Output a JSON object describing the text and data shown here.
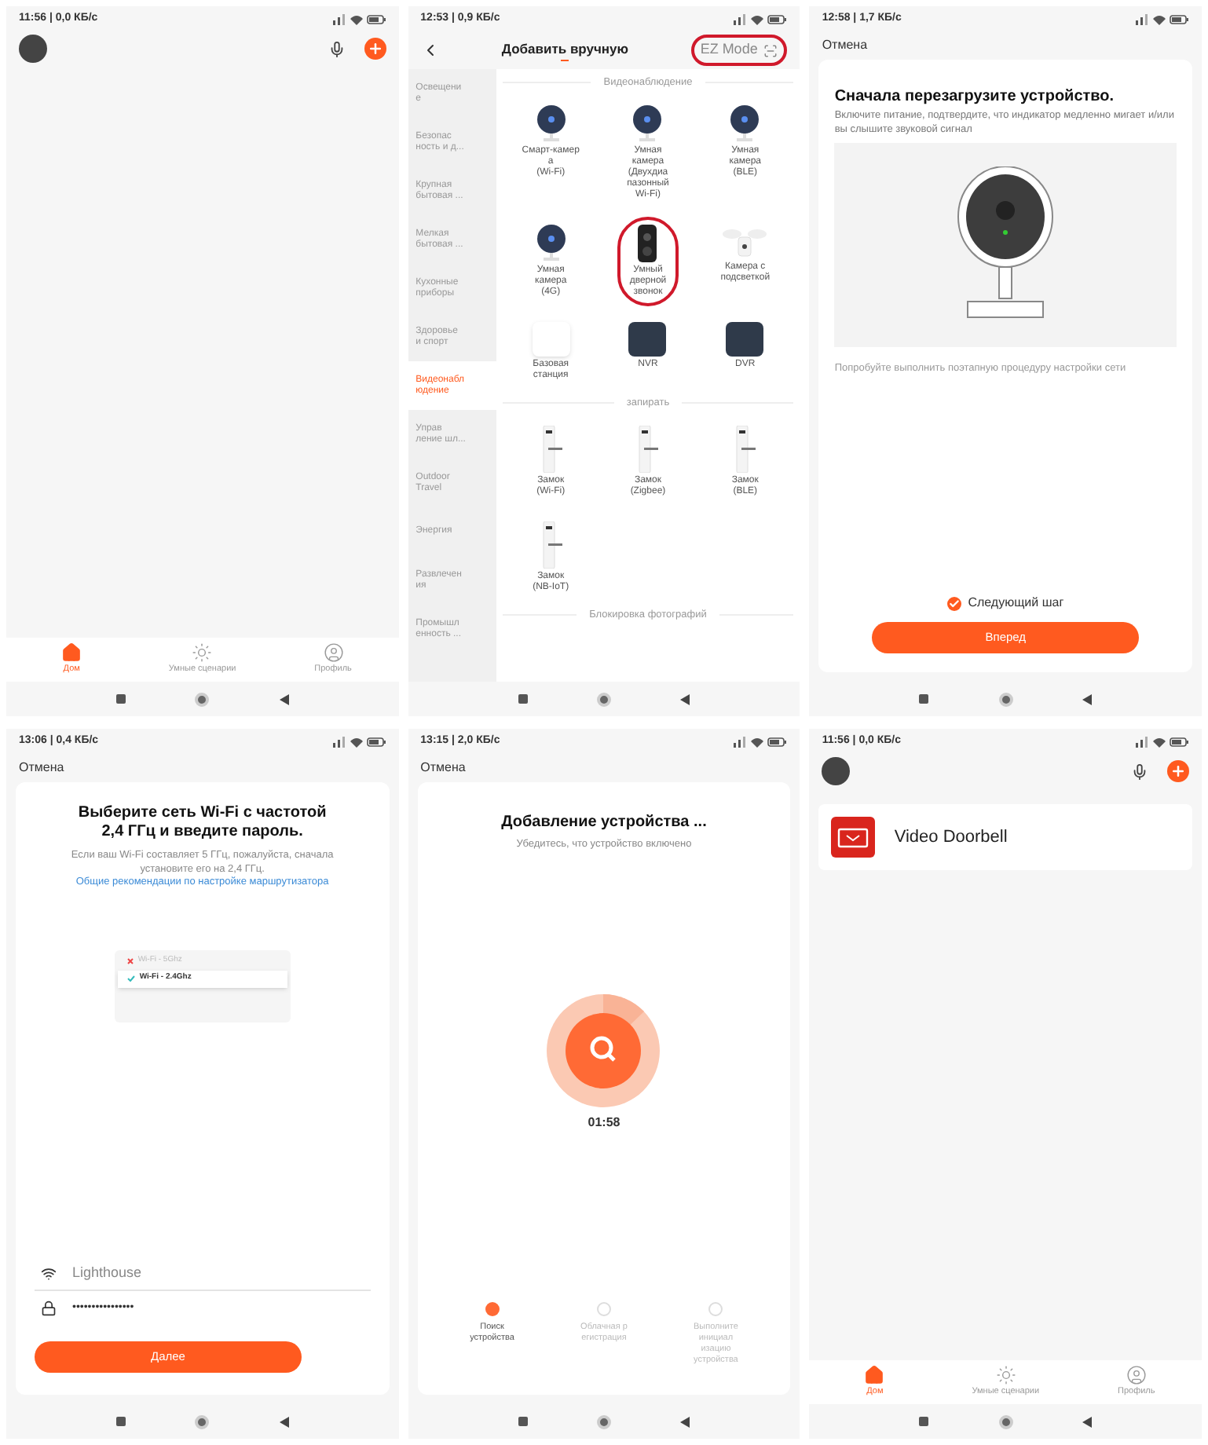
{
  "screens": [
    {
      "kind": "home",
      "status": "11:56 | 0,0 КБ/с",
      "tabs": [
        {
          "kind": "home",
          "label": "Дом",
          "selected": true
        },
        {
          "kind": "scenes",
          "label": "Умные сценарии",
          "selected": false
        },
        {
          "kind": "profile",
          "label": "Профиль",
          "selected": false
        }
      ]
    },
    {
      "kind": "catalog",
      "status": "12:53 | 0,9 КБ/с",
      "title": "Добавить вручную",
      "ez_mode": {
        "label": "EZ Mode",
        "circled": true
      },
      "categories": [
        {
          "label": "Освещени\nе",
          "selected": false
        },
        {
          "label": "Безопас\nность и д...",
          "selected": false
        },
        {
          "label": "Крупная\nбытовая ...",
          "selected": false
        },
        {
          "label": "Мелкая\nбытовая ...",
          "selected": false
        },
        {
          "label": "Кухонные\nприборы",
          "selected": false
        },
        {
          "label": "Здоровье\nи спорт",
          "selected": false
        },
        {
          "label": "Видеонабл\nюдение",
          "selected": true
        },
        {
          "label": "Управ\nление шл...",
          "selected": false
        },
        {
          "label": "Outdoor\nTravel",
          "selected": false
        },
        {
          "label": "Энергия",
          "selected": false
        },
        {
          "label": "Развлечен\nия",
          "selected": false
        },
        {
          "label": "Промышл\nенность ...",
          "selected": false
        }
      ],
      "sections": [
        {
          "title": "Видеонаблюдение",
          "items": [
            {
              "kind": "camera",
              "label": "Смарт-камер\nа\n(Wi-Fi)",
              "circled": false
            },
            {
              "kind": "camera",
              "label": "Умная\nкамера\n(Двухдиа\nпазонный\nWi-Fi)",
              "circled": false
            },
            {
              "kind": "camera",
              "label": "Умная\nкамера\n(BLE)",
              "circled": false
            },
            {
              "kind": "camera",
              "label": "Умная\nкамера\n(4G)",
              "circled": false
            },
            {
              "kind": "doorbell",
              "label": "Умный\nдверной\nзвонок",
              "circled": true
            },
            {
              "kind": "floodlight",
              "label": "Камера с\nподсветкой",
              "circled": false
            },
            {
              "kind": "hub",
              "label": "Базовая\nстанция",
              "circled": false
            },
            {
              "kind": "recorder",
              "label": "NVR",
              "circled": false
            },
            {
              "kind": "recorder",
              "label": "DVR",
              "circled": false
            }
          ]
        },
        {
          "title": "запирать",
          "items": [
            {
              "kind": "lock",
              "label": "Замок\n(Wi-Fi)",
              "circled": false
            },
            {
              "kind": "lock",
              "label": "Замок\n(Zigbee)",
              "circled": false
            },
            {
              "kind": "lock",
              "label": "Замок\n(BLE)",
              "circled": false
            },
            {
              "kind": "lock",
              "label": "Замок\n(NB-IoT)",
              "circled": false
            }
          ]
        },
        {
          "title": "Блокировка фотографий"
        }
      ]
    },
    {
      "kind": "reset",
      "status": "12:58 | 1,7 КБ/с",
      "cancel": "Отмена",
      "title": "Сначала перезагрузите устройство.",
      "text": "Включите питание, подтвердите, что индикатор медленно мигает и/или вы слышите звуковой сигнал",
      "link": "Попробуйте выполнить поэтапную процедуру настройки сети",
      "confirm": {
        "label": "Следующий шаг",
        "checked": true
      },
      "button": "Вперед"
    },
    {
      "kind": "wifi",
      "status": "13:06 | 0,4 КБ/с",
      "cancel": "Отмена",
      "title": "Выберите сеть Wi-Fi с частотой 2,4 ГГц и введите пароль.",
      "text": "Если ваш Wi-Fi составляет 5 ГГц, пожалуйста, сначала установите его на 2,4 ГГц.",
      "link": "Общие рекомендации по настройке маршрутизатора",
      "networks": [
        {
          "label": "Wi-Fi - 5Ghz",
          "selected": false
        },
        {
          "label": "Wi-Fi - 2.4Ghz",
          "selected": true
        }
      ],
      "ssid": "Lighthouse",
      "password": "••••••••••••••••",
      "button": "Далее"
    },
    {
      "kind": "search",
      "status": "13:15 | 2,0 КБ/с",
      "cancel": "Отмена",
      "title": "Добавление устройства ...",
      "text": "Убедитесь, что устройство включено",
      "timer": "01:58",
      "steps": [
        {
          "label": "Поиск\nустройства",
          "active": true
        },
        {
          "label": "Облачная р\nегистрация",
          "active": false
        },
        {
          "label": "Выполните\nинициал\nизацию\nустройства",
          "active": false
        }
      ]
    },
    {
      "kind": "home",
      "status": "11:56 | 0,0 КБ/с",
      "devices": [
        {
          "name": "Video Doorbell"
        }
      ],
      "tabs": [
        {
          "kind": "home",
          "label": "Дом",
          "selected": true
        },
        {
          "kind": "scenes",
          "label": "Умные сценарии",
          "selected": false
        },
        {
          "kind": "profile",
          "label": "Профиль",
          "selected": false
        }
      ]
    }
  ]
}
